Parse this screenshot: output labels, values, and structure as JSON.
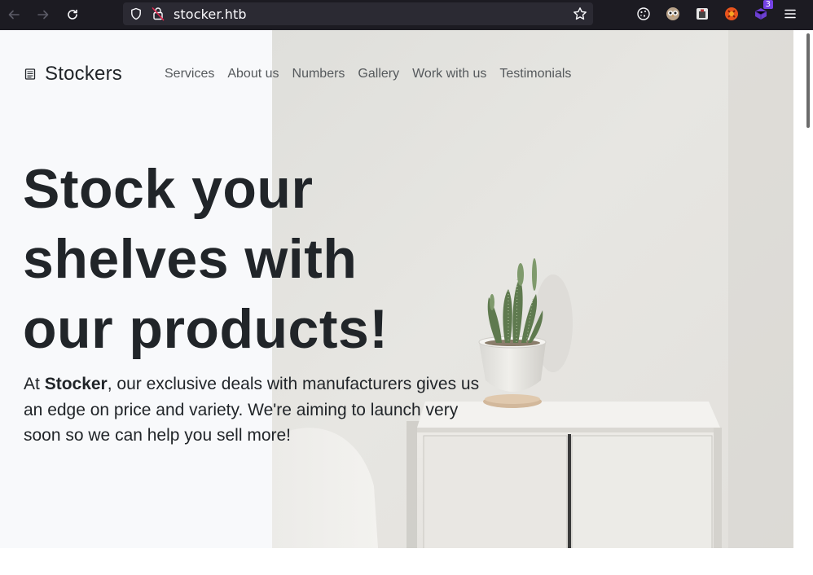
{
  "browser": {
    "url": "stocker.htb",
    "extensions_badge": "3"
  },
  "site": {
    "brand": "Stockers",
    "nav": [
      "Services",
      "About us",
      "Numbers",
      "Gallery",
      "Work with us",
      "Testimonials"
    ]
  },
  "hero": {
    "headline_lines": [
      "Stock your",
      "shelves with",
      "our products!"
    ],
    "lead_prefix": "At ",
    "lead_bold": "Stocker",
    "lead_suffix": ", our exclusive deals with manufacturers gives us an edge on price and variety. We're aiming to launch very soon so we can help you sell more!"
  },
  "colors": {
    "chrome_bg": "#1c1b22",
    "urlbar_bg": "#2b2a33",
    "hero_bg": "#f8f9fb",
    "text_dark": "#212529",
    "nav_text": "#55595c",
    "extension_badge": "#7542e5"
  },
  "icons": {
    "back": "arrow-left-icon",
    "forward": "arrow-right-icon",
    "reload": "reload-icon",
    "shield": "tracking-protection-icon",
    "lock": "insecure-lock-icon",
    "bookmark": "star-icon",
    "menu": "hamburger-menu-icon",
    "brand": "shop-icon"
  }
}
